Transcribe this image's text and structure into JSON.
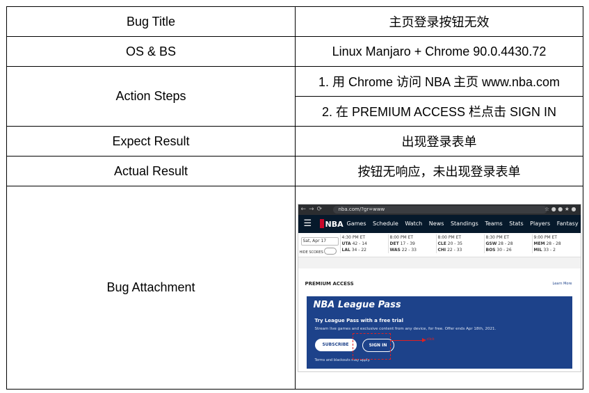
{
  "report": {
    "bug_title_label": "Bug Title",
    "bug_title_value": "主页登录按钮无效",
    "os_label": "OS & BS",
    "os_value": "Linux Manjaro + Chrome  90.0.4430.72",
    "steps_label": "Action Steps",
    "step_1": "1. 用 Chrome 访问 NBA 主页 www.nba.com",
    "step_2": "2. 在 PREMIUM ACCESS 栏点击 SIGN IN",
    "expect_label": "Expect Result",
    "expect_value": "出现登录表单",
    "actual_label": "Actual Result",
    "actual_value": "按钮无响应，未出现登录表单",
    "attachment_label": "Bug Attachment"
  },
  "screenshot": {
    "url": "nba.com/?gr=www",
    "nav": [
      "Games",
      "Schedule",
      "Watch",
      "News",
      "Standings",
      "Teams",
      "Stats",
      "Players",
      "Fantasy"
    ],
    "logo": "NBA",
    "date": "Sat, Apr 17",
    "hide_scores": "HIDE SCORES",
    "games": [
      {
        "status": "4:30 PM ET",
        "t1": "UTA",
        "t2": "LAL",
        "r1": "42 - 14",
        "r2": "34 - 22"
      },
      {
        "status": "8:00 PM ET",
        "t1": "DET",
        "t2": "WAS",
        "r1": "17 - 39",
        "r2": "22 - 33"
      },
      {
        "status": "8:00 PM ET",
        "t1": "CLE",
        "t2": "CHI",
        "r1": "20 - 35",
        "r2": "22 - 33"
      },
      {
        "status": "8:30 PM ET",
        "t1": "GSW",
        "t2": "BOS",
        "r1": "28 - 28",
        "r2": "30 - 26"
      },
      {
        "status": "9:00 PM ET",
        "t1": "MEM",
        "t2": "MIL",
        "r1": "28 - 28",
        "r2": "33 - 2"
      }
    ],
    "premium_title": "PREMIUM ACCESS",
    "learn_more": "Learn More",
    "brand": "NBA League Pass",
    "trial_heading": "Try League Pass with a free trial",
    "trial_desc": "Stream live games and exclusive content from any device, for free. Offer ends Apr 18th, 2021.",
    "subscribe": "SUBSCRIBE",
    "sign_in": "SIGN IN",
    "terms": "Terms and blackouts may apply.",
    "annotation": "click"
  }
}
